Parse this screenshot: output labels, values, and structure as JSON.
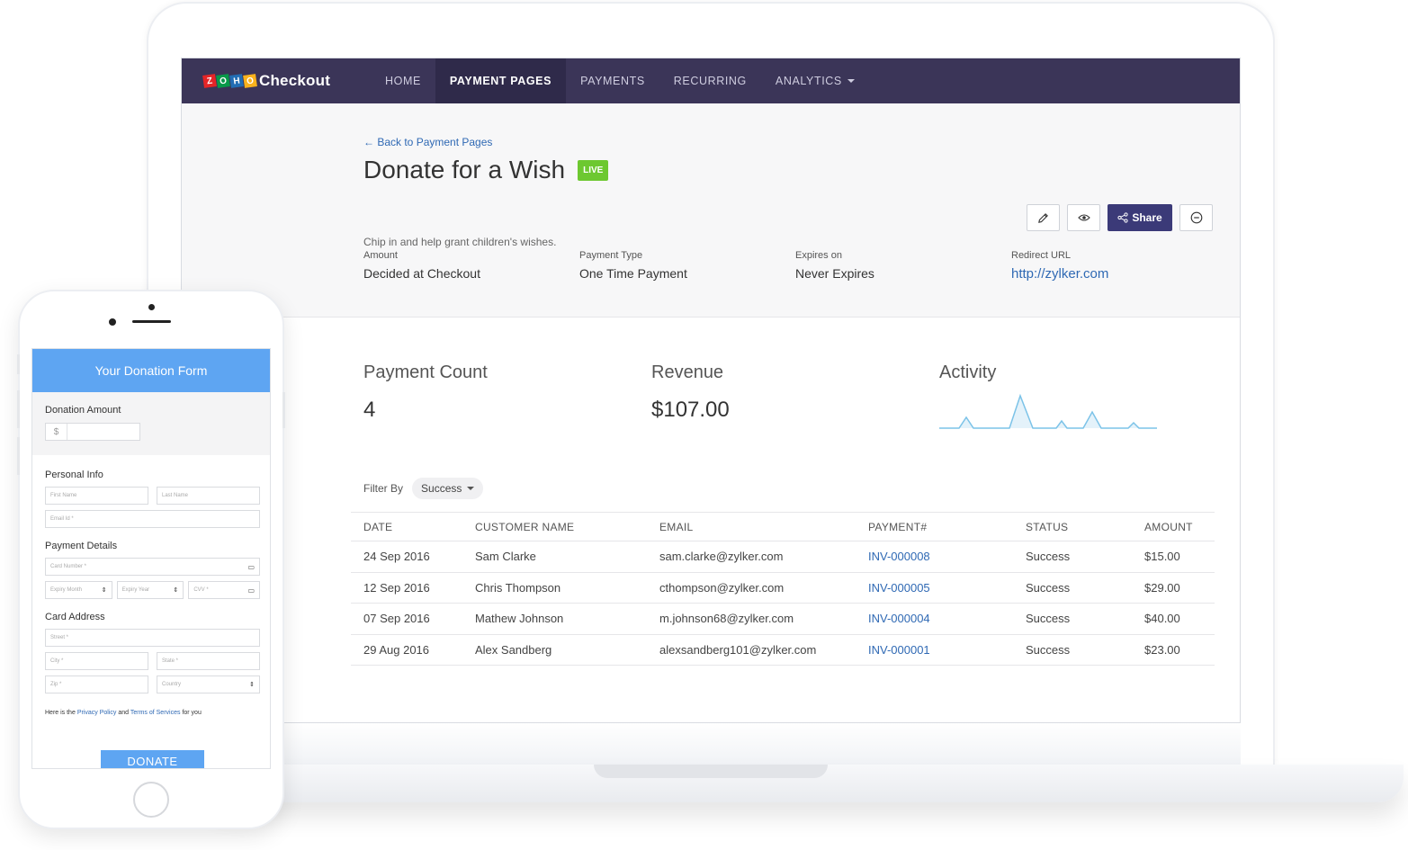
{
  "app": {
    "logo_letters": [
      "Z",
      "O",
      "H",
      "O"
    ],
    "logo_colors": [
      "#e42527",
      "#089949",
      "#226db4",
      "#f9b21d"
    ],
    "logo_text": "Checkout"
  },
  "nav": {
    "items": [
      {
        "label": "HOME"
      },
      {
        "label": "PAYMENT PAGES"
      },
      {
        "label": "PAYMENTS"
      },
      {
        "label": "RECURRING"
      },
      {
        "label": "ANALYTICS"
      }
    ],
    "active": "PAYMENT PAGES"
  },
  "header": {
    "back_link": "← Back to Payment Pages",
    "title": "Donate for a Wish",
    "badge": "LIVE",
    "subtitle": "Chip in and help grant children's wishes.",
    "actions": {
      "edit_icon": "pencil-icon",
      "preview_icon": "eye-icon",
      "share_label": "Share",
      "more_icon": "minus-circle-icon"
    }
  },
  "info": [
    {
      "label": "Amount",
      "value": "Decided at Checkout"
    },
    {
      "label": "Payment Type",
      "value": "One Time Payment"
    },
    {
      "label": "Expires on",
      "value": "Never Expires"
    },
    {
      "label": "Redirect URL",
      "value": "http://zylker.com"
    }
  ],
  "stats": {
    "payment_count_label": "Payment Count",
    "payment_count": "4",
    "revenue_label": "Revenue",
    "revenue": "$107.00",
    "activity_label": "Activity"
  },
  "filter": {
    "label": "Filter By",
    "value": "Success"
  },
  "table": {
    "columns": [
      "DATE",
      "CUSTOMER NAME",
      "EMAIL",
      "PAYMENT#",
      "STATUS",
      "AMOUNT"
    ],
    "rows": [
      [
        "24 Sep 2016",
        "Sam Clarke",
        "sam.clarke@zylker.com",
        "INV-000008",
        "Success",
        "$15.00"
      ],
      [
        "12 Sep 2016",
        "Chris Thompson",
        "cthompson@zylker.com",
        "INV-000005",
        "Success",
        "$29.00"
      ],
      [
        "07 Sep 2016",
        "Mathew Johnson",
        "m.johnson68@zylker.com",
        "INV-000004",
        "Success",
        "$40.00"
      ],
      [
        "29 Aug 2016",
        "Alex Sandberg",
        "alexsandberg101@zylker.com",
        "INV-000001",
        "Success",
        "$23.00"
      ]
    ]
  },
  "phone_form": {
    "title": "Your Donation Form",
    "donation_amount_label": "Donation Amount",
    "currency": "$",
    "personal_info_label": "Personal Info",
    "first_name": "First Name",
    "last_name": "Last Name",
    "email": "Email Id *",
    "payment_details_label": "Payment Details",
    "card_number": "Card Number *",
    "expiry_month": "Expiry Month",
    "expiry_year": "Expiry Year",
    "cvv": "CVV *",
    "card_address_label": "Card Address",
    "street": "Street *",
    "city": "City *",
    "state": "State *",
    "zip": "Zip *",
    "country": "Country",
    "policy_prefix": "Here  is the",
    "privacy_policy": "Privacy Policy",
    "and": "and",
    "terms": "Terms of Services",
    "policy_suffix": "for you",
    "donate_button": "DONATE"
  },
  "colors": {
    "nav_bg": "#3b3558",
    "share_button": "#3b3a78",
    "live_badge": "#6dc830",
    "link": "#2f69b4",
    "form_header": "#5ea5f2",
    "sparkline": "#7cc3e8"
  }
}
